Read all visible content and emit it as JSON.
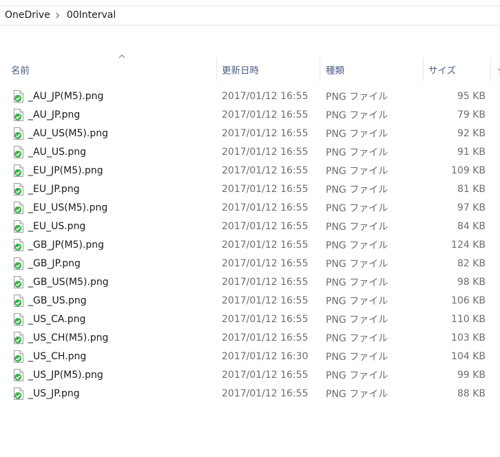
{
  "breadcrumb": {
    "items": [
      "OneDrive",
      "00Interval"
    ]
  },
  "columns": {
    "name": "名前",
    "date": "更新日時",
    "type": "種類",
    "size": "サイズ",
    "more": "ク"
  },
  "files": [
    {
      "name": "_AU_JP(M5).png",
      "date": "2017/01/12 16:55",
      "type": "PNG ファイル",
      "size": "95 KB"
    },
    {
      "name": "_AU_JP.png",
      "date": "2017/01/12 16:55",
      "type": "PNG ファイル",
      "size": "79 KB"
    },
    {
      "name": "_AU_US(M5).png",
      "date": "2017/01/12 16:55",
      "type": "PNG ファイル",
      "size": "92 KB"
    },
    {
      "name": "_AU_US.png",
      "date": "2017/01/12 16:55",
      "type": "PNG ファイル",
      "size": "91 KB"
    },
    {
      "name": "_EU_JP(M5).png",
      "date": "2017/01/12 16:55",
      "type": "PNG ファイル",
      "size": "109 KB"
    },
    {
      "name": "_EU_JP.png",
      "date": "2017/01/12 16:55",
      "type": "PNG ファイル",
      "size": "81 KB"
    },
    {
      "name": "_EU_US(M5).png",
      "date": "2017/01/12 16:55",
      "type": "PNG ファイル",
      "size": "97 KB"
    },
    {
      "name": "_EU_US.png",
      "date": "2017/01/12 16:55",
      "type": "PNG ファイル",
      "size": "84 KB"
    },
    {
      "name": "_GB_JP(M5).png",
      "date": "2017/01/12 16:55",
      "type": "PNG ファイル",
      "size": "124 KB"
    },
    {
      "name": "_GB_JP.png",
      "date": "2017/01/12 16:55",
      "type": "PNG ファイル",
      "size": "82 KB"
    },
    {
      "name": "_GB_US(M5).png",
      "date": "2017/01/12 16:55",
      "type": "PNG ファイル",
      "size": "98 KB"
    },
    {
      "name": "_GB_US.png",
      "date": "2017/01/12 16:55",
      "type": "PNG ファイル",
      "size": "106 KB"
    },
    {
      "name": "_US_CA.png",
      "date": "2017/01/12 16:55",
      "type": "PNG ファイル",
      "size": "110 KB"
    },
    {
      "name": "_US_CH(M5).png",
      "date": "2017/01/12 16:55",
      "type": "PNG ファイル",
      "size": "103 KB"
    },
    {
      "name": "_US_CH.png",
      "date": "2017/01/12 16:30",
      "type": "PNG ファイル",
      "size": "104 KB"
    },
    {
      "name": "_US_JP(M5).png",
      "date": "2017/01/12 16:55",
      "type": "PNG ファイル",
      "size": "99 KB"
    },
    {
      "name": "_US_JP.png",
      "date": "2017/01/12 16:55",
      "type": "PNG ファイル",
      "size": "88 KB"
    }
  ],
  "icons": {
    "file": "png-file-synced-icon",
    "breadcrumb_separator": "chevron-right-icon",
    "sort": "sort-ascending-icon"
  },
  "colors": {
    "header_text": "#4d6082",
    "secondary_text": "#6d6d6d",
    "sync_check": "#3bb24a"
  }
}
